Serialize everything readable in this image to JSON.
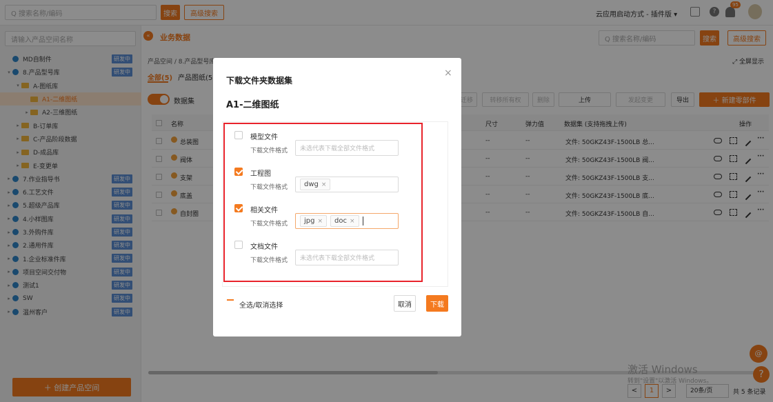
{
  "topbar": {
    "search_placeholder": "Q 搜索名称/编码",
    "search_btn": "搜索",
    "adv_btn": "高级搜索",
    "launch": "云应用启动方式 - 插件版 ▾",
    "notif_count": "95"
  },
  "sidebar": {
    "search_placeholder": "请输入产品空间名称",
    "create_btn": "＋ 创建产品空间",
    "items": [
      {
        "label": "MD自制件",
        "level": 0,
        "type": "space",
        "badge": "研发中",
        "arrow": ""
      },
      {
        "label": "8.产品型号库",
        "level": 0,
        "type": "space",
        "badge": "研发中",
        "arrow": "▾"
      },
      {
        "label": "A-图纸库",
        "level": 1,
        "type": "folder",
        "badge": "",
        "arrow": "▾"
      },
      {
        "label": "A1-二维图纸",
        "level": 2,
        "type": "folder",
        "badge": "",
        "arrow": "",
        "selected": true
      },
      {
        "label": "A2-三维图纸",
        "level": 2,
        "type": "folder",
        "badge": "",
        "arrow": "▸"
      },
      {
        "label": "B-订单库",
        "level": 1,
        "type": "folder",
        "badge": "",
        "arrow": "▸"
      },
      {
        "label": "C-产品阶段数据",
        "level": 1,
        "type": "folder",
        "badge": "",
        "arrow": "▸"
      },
      {
        "label": "D-成品库",
        "level": 1,
        "type": "folder",
        "badge": "",
        "arrow": "▸"
      },
      {
        "label": "E-变更单",
        "level": 1,
        "type": "folder",
        "badge": "",
        "arrow": "▸"
      },
      {
        "label": "7.作业指导书",
        "level": 0,
        "type": "space",
        "badge": "研发中",
        "arrow": "▸"
      },
      {
        "label": "6.工艺文件",
        "level": 0,
        "type": "space",
        "badge": "研发中",
        "arrow": "▸"
      },
      {
        "label": "5.超级产品库",
        "level": 0,
        "type": "space",
        "badge": "研发中",
        "arrow": "▸"
      },
      {
        "label": "4.小样图库",
        "level": 0,
        "type": "space",
        "badge": "研发中",
        "arrow": "▸"
      },
      {
        "label": "3.外购件库",
        "level": 0,
        "type": "space",
        "badge": "研发中",
        "arrow": "▸"
      },
      {
        "label": "2.通用件库",
        "level": 0,
        "type": "space",
        "badge": "研发中",
        "arrow": "▸"
      },
      {
        "label": "1.企业标准件库",
        "level": 0,
        "type": "space",
        "badge": "研发中",
        "arrow": "▸"
      },
      {
        "label": "项目空间交付物",
        "level": 0,
        "type": "space",
        "badge": "研发中",
        "arrow": "▸"
      },
      {
        "label": "测试1",
        "level": 0,
        "type": "space",
        "badge": "研发中",
        "arrow": "▸"
      },
      {
        "label": "SW",
        "level": 0,
        "type": "space",
        "badge": "研发中",
        "arrow": "▸"
      },
      {
        "label": "温州客户",
        "level": 0,
        "type": "space",
        "badge": "研发中",
        "arrow": "▸"
      }
    ]
  },
  "main": {
    "title": "业务数据",
    "search_placeholder": "Q 搜索名称/编码",
    "search_btn": "搜索",
    "adv_btn": "高级搜索",
    "breadcrumb": "产品空间 / 8.产品型号库 / A-图纸库 / A1-二维图纸",
    "fullscreen": "⤢ 全屏显示",
    "tab_all": "全部",
    "tab_all_count": "(5)",
    "tab_drawings": "产品图纸(5)",
    "dataset_label": "数据集",
    "btn_move": "迁移",
    "btn_transfer": "转移所有权",
    "btn_delete": "删除",
    "btn_upload": "上传",
    "btn_change": "发起变更",
    "btn_export": "导出",
    "btn_new": "＋ 新建零部件",
    "col_name": "名称",
    "col_size": "尺寸",
    "col_elastic": "弹力值",
    "col_dataset": "数据集 (支持拖拽上传)",
    "col_ops": "操作",
    "rows": [
      {
        "name": "总装图",
        "dataset": "文件:  50GKZ43F-1500LB 总..."
      },
      {
        "name": "阀体",
        "dataset": "文件:  50GKZ43F-1500LB 阀..."
      },
      {
        "name": "支架",
        "dataset": "文件:  50GKZ43F-1500LB 支..."
      },
      {
        "name": "底盖",
        "dataset": "文件:  50GKZ43F-1500LB 底..."
      },
      {
        "name": "自封圈",
        "dataset": "文件:  50GKZ43F-1500LB 自..."
      }
    ],
    "dash": "--",
    "pager": {
      "current": "1",
      "page_size": "20条/页",
      "total": "共 5 条记录"
    },
    "watermark1": "激活 Windows",
    "watermark2": "转到\"设置\"以激活 Windows。"
  },
  "dialog": {
    "title": "下载文件夹数据集",
    "subtitle": "A1-二维图纸",
    "format_label": "下载文件格式",
    "empty_placeholder": "未选代表下载全部文件格式",
    "sections": [
      {
        "name": "模型文件",
        "checked": false,
        "tags": []
      },
      {
        "name": "工程图",
        "checked": true,
        "tags": [
          "dwg"
        ]
      },
      {
        "name": "相关文件",
        "checked": true,
        "tags": [
          "jpg",
          "doc"
        ]
      },
      {
        "name": "文档文件",
        "checked": false,
        "tags": []
      }
    ],
    "select_all": "全选/取消选择",
    "cancel": "取消",
    "download": "下载"
  },
  "colors": {
    "accent": "#f47a1f",
    "highlight": "#e8232b",
    "badge": "#5b8fd6"
  }
}
